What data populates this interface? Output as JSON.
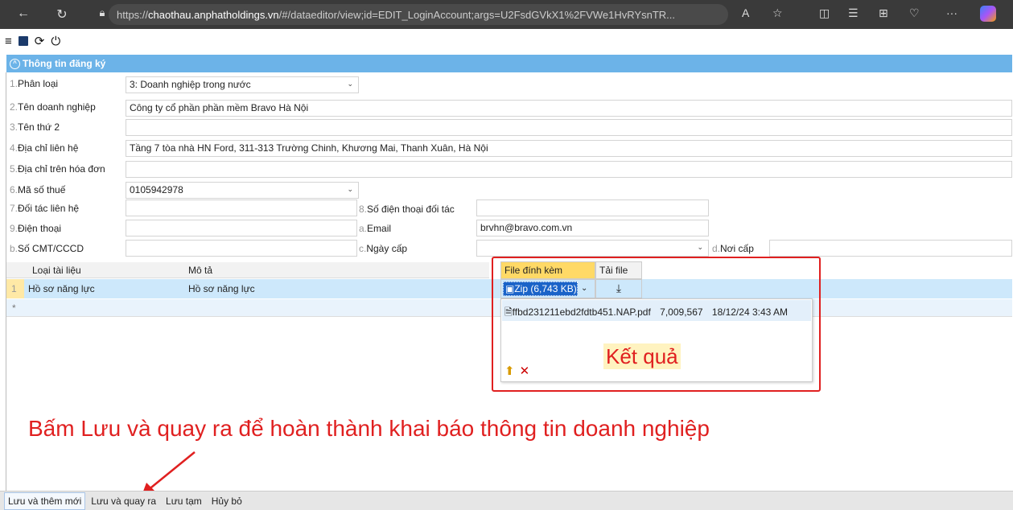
{
  "browser": {
    "url_prefix": "https://",
    "url_host": "chaothau.anphatholdings.vn",
    "url_rest": "/#/dataeditor/view;id=EDIT_LoginAccount;args=U2FsdGVkX1%2FVWe1HvRYsnTR..."
  },
  "toolbar": {
    "icons": [
      "menu-icon",
      "save-icon",
      "refresh-icon",
      "power-icon"
    ]
  },
  "section": {
    "title": "Thông tin đăng ký"
  },
  "form": {
    "f1": {
      "num": "1.",
      "label": "Phân loại",
      "value": "3: Doanh nghiệp trong nước"
    },
    "f2": {
      "num": "2.",
      "label": "Tên doanh nghiệp",
      "value": "Công ty cổ phần phần mềm Bravo Hà Nội"
    },
    "f3": {
      "num": "3.",
      "label": "Tên thứ 2",
      "value": ""
    },
    "f4": {
      "num": "4.",
      "label": "Địa chỉ liên hệ",
      "value": "Tầng 7 tòa nhà HN Ford, 311-313 Trường Chinh, Khương Mai, Thanh Xuân, Hà Nội"
    },
    "f5": {
      "num": "5.",
      "label": "Địa chỉ trên hóa đơn",
      "value": ""
    },
    "f6": {
      "num": "6.",
      "label": "Mã số thuế",
      "value": "0105942978"
    },
    "f7": {
      "num": "7.",
      "label": "Đối tác liên hệ",
      "value": ""
    },
    "f8": {
      "num": "8.",
      "label": "Số điện thoại đối tác",
      "value": ""
    },
    "f9": {
      "num": "9.",
      "label": "Điện thoại",
      "value": ""
    },
    "fa": {
      "num": "a.",
      "label": "Email",
      "value": "brvhn@bravo.com.vn"
    },
    "fb": {
      "num": "b.",
      "label": "Số CMT/CCCD",
      "value": ""
    },
    "fc": {
      "num": "c.",
      "label": "Ngày cấp",
      "value": ""
    },
    "fd": {
      "num": "d.",
      "label": "Nơi cấp",
      "value": ""
    }
  },
  "grid": {
    "headers": {
      "type": "Loại tài liệu",
      "desc": "Mô tả",
      "file": "File đính kèm",
      "download": "Tải file"
    },
    "rows": [
      {
        "num": "1",
        "type": "Hồ sơ năng lực",
        "desc": "Hồ sơ năng lực",
        "file": "Zip (6,743 KB)"
      }
    ],
    "new_row_marker": "*"
  },
  "attachment": {
    "name": "ffbd231211ebd2fdtb451.NAP.pdf",
    "size": "7,009,567",
    "date": "18/12/24 3:43 AM"
  },
  "annotations": {
    "result": "Kết quả",
    "instruction": "Bấm Lưu và quay ra để hoàn thành khai báo thông tin doanh nghiệp"
  },
  "buttons": {
    "save_new": "Lưu và thêm mới",
    "save_back": "Lưu và quay ra",
    "save_temp": "Lưu tạm",
    "cancel": "Hủy bỏ"
  },
  "colors": {
    "header": "#6cb3e8",
    "annotation": "#e02020",
    "selection": "#1a63c8",
    "file_header": "#ffd966"
  }
}
